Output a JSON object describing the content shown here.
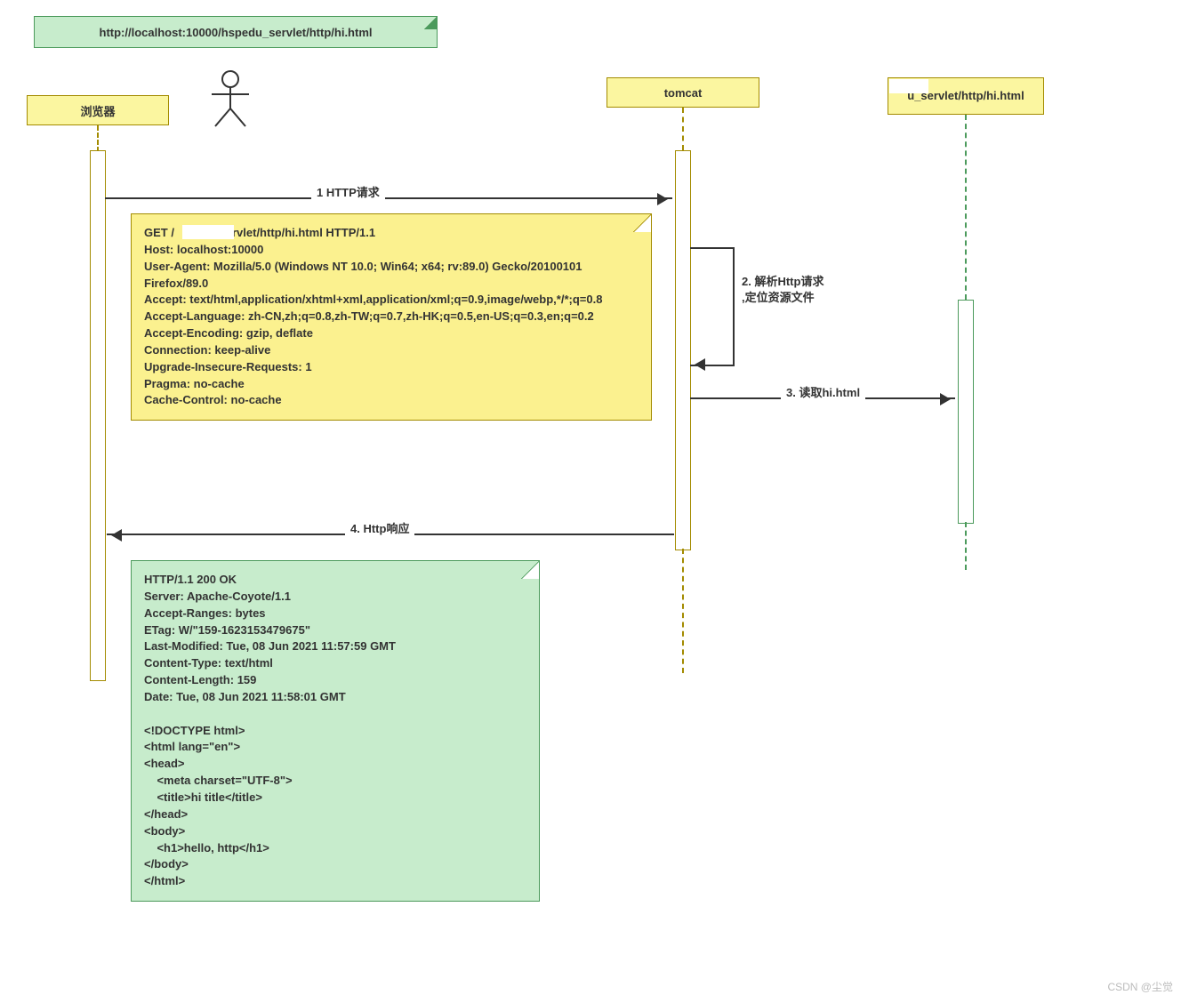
{
  "url_header": "http://localhost:10000/hspedu_servlet/http/hi.html",
  "participants": {
    "browser": "浏览器",
    "tomcat": "tomcat",
    "file": "u_servlet/http/hi.html"
  },
  "messages": {
    "m1": "1 HTTP请求",
    "m2_line1": "2. 解析Http请求",
    "m2_line2": ",定位资源文件",
    "m3": "3. 读取hi.html",
    "m4": "4. Http响应"
  },
  "request_note": "GET /            _servlet/http/hi.html HTTP/1.1\nHost: localhost:10000\nUser-Agent: Mozilla/5.0 (Windows NT 10.0; Win64; x64; rv:89.0) Gecko/20100101 Firefox/89.0\nAccept: text/html,application/xhtml+xml,application/xml;q=0.9,image/webp,*/*;q=0.8\nAccept-Language: zh-CN,zh;q=0.8,zh-TW;q=0.7,zh-HK;q=0.5,en-US;q=0.3,en;q=0.2\nAccept-Encoding: gzip, deflate\nConnection: keep-alive\nUpgrade-Insecure-Requests: 1\nPragma: no-cache\nCache-Control: no-cache",
  "response_note": "HTTP/1.1 200 OK\nServer: Apache-Coyote/1.1\nAccept-Ranges: bytes\nETag: W/\"159-1623153479675\"\nLast-Modified: Tue, 08 Jun 2021 11:57:59 GMT\nContent-Type: text/html\nContent-Length: 159\nDate: Tue, 08 Jun 2021 11:58:01 GMT\n\n<!DOCTYPE html>\n<html lang=\"en\">\n<head>\n    <meta charset=\"UTF-8\">\n    <title>hi title</title>\n</head>\n<body>\n    <h1>hello, http</h1>\n</body>\n</html>",
  "watermark": "CSDN @尘觉"
}
